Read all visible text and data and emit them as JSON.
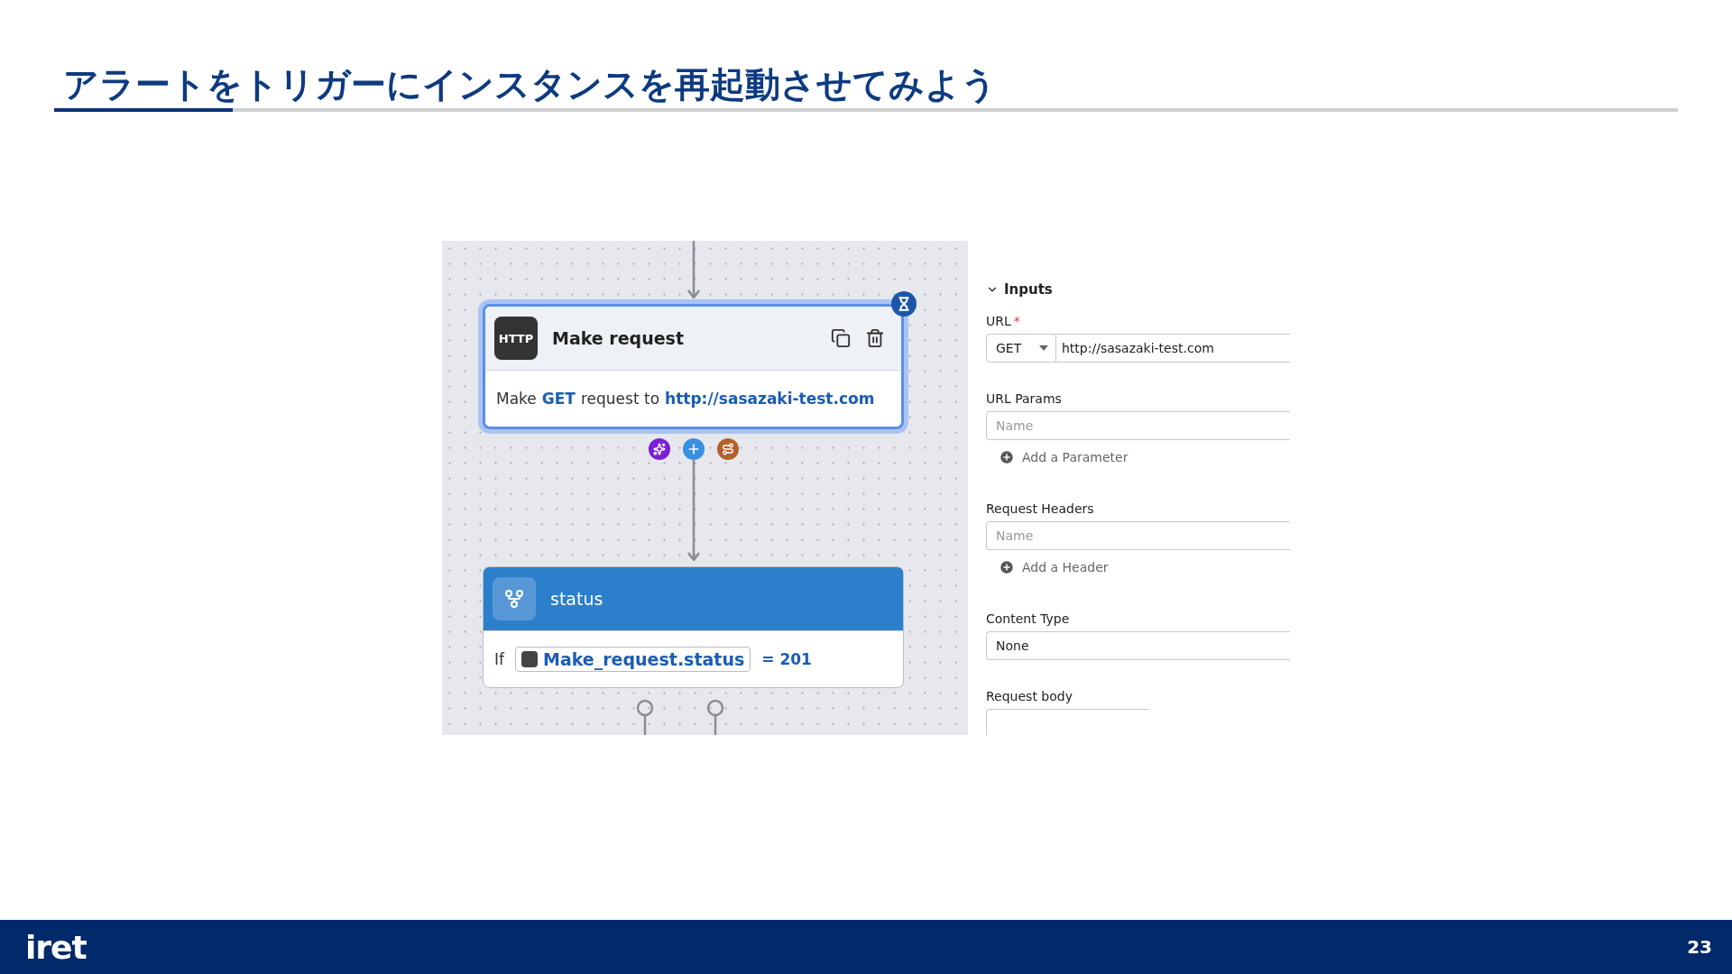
{
  "slide": {
    "title": "アラートをトリガーにインスタンスを再起動させてみよう",
    "logo": "iret",
    "page_number": "23"
  },
  "canvas": {
    "request_node": {
      "selected": true,
      "badge": "HTTP",
      "title": "Make request",
      "body": [
        {
          "kind": "text",
          "text": "Make"
        },
        {
          "kind": "value",
          "text": "GET"
        },
        {
          "kind": "text",
          "text": "request to"
        },
        {
          "kind": "value",
          "text": "http://sasazaki-test.com"
        }
      ]
    },
    "handles": [
      {
        "kind": "sparkle",
        "color": "#7a1fd6"
      },
      {
        "kind": "plus",
        "color": "#3b8fe0"
      },
      {
        "kind": "route",
        "color": "#b1612a"
      }
    ],
    "condition_node": {
      "title": "status",
      "condition": [
        {
          "kind": "text",
          "text": "If"
        },
        {
          "kind": "ref",
          "text": "Make_request.status"
        },
        {
          "kind": "value",
          "text": "= 201"
        }
      ]
    }
  },
  "panel": {
    "section": {
      "title": "Inputs",
      "expanded": true
    },
    "fields": [
      {
        "kind": "method_url",
        "label": "URL",
        "required_mark": "*",
        "method": "GET",
        "value": "http://sasazaki-test.com"
      },
      {
        "kind": "key_list",
        "label": "URL Params",
        "placeholder": "Name",
        "add": "Add a Parameter"
      },
      {
        "kind": "key_list",
        "label": "Request Headers",
        "placeholder": "Name",
        "add": "Add a Header"
      },
      {
        "kind": "select",
        "label": "Content Type",
        "value": "None"
      },
      {
        "kind": "textarea",
        "label": "Request body"
      }
    ]
  }
}
